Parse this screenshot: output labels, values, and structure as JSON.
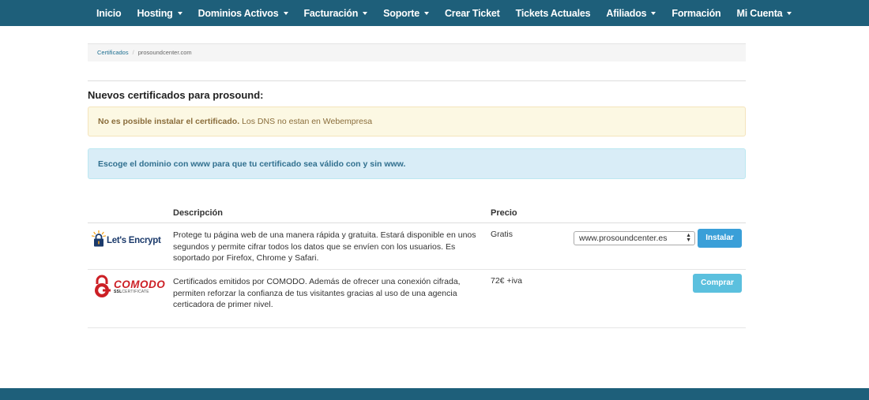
{
  "nav": {
    "items": [
      {
        "label": "Inicio",
        "dropdown": false
      },
      {
        "label": "Hosting",
        "dropdown": true
      },
      {
        "label": "Dominios Activos",
        "dropdown": true
      },
      {
        "label": "Facturación",
        "dropdown": true
      },
      {
        "label": "Soporte",
        "dropdown": true
      },
      {
        "label": "Crear Ticket",
        "dropdown": false
      },
      {
        "label": "Tickets Actuales",
        "dropdown": false
      },
      {
        "label": "Afiliados",
        "dropdown": true
      },
      {
        "label": "Formación",
        "dropdown": false
      },
      {
        "label": "Mi Cuenta",
        "dropdown": true
      }
    ]
  },
  "breadcrumb": {
    "link": "Certificados",
    "separator": "/",
    "current": "prosoundcenter.com"
  },
  "section_title": "Nuevos certificados para prosound:",
  "alerts": {
    "warning_bold": "No es posible instalar el certificado.",
    "warning_text": " Los DNS no estan en Webempresa",
    "info": "Escoge el dominio con www para que tu certificado sea válido con y sin www."
  },
  "table": {
    "headers": {
      "description": "Descripción",
      "price": "Precio"
    },
    "rows": [
      {
        "logo": "Let's Encrypt",
        "description": "Protege tu página web de una manera rápida y gratuita. Estará disponible en unos segundos y permite cifrar todos los datos que se envíen con los usuarios. Es soportado por Firefox, Chrome y Safari.",
        "price": "Gratis",
        "select_value": "www.prosoundcenter.es",
        "button": "Instalar"
      },
      {
        "logo": "COMODO",
        "logo_sub_bold": "SSL",
        "logo_sub": "CERTIFICATE",
        "description": "Certificados emitidos por COMODO. Además de ofrecer una conexión cifrada, permiten reforzar la confianza de tus visitantes gracias al uso de una agencia certicadora de primer nivel.",
        "price": "72€ +iva",
        "button": "Comprar"
      }
    ]
  },
  "colors": {
    "nav_bg": "#1e5f7a",
    "warning_bg": "#fcf8e3",
    "info_bg": "#d9edf7",
    "instalar_btn": "#3a9fd8",
    "comprar_btn": "#5bc0de",
    "comodo_red": "#cc1f25"
  }
}
